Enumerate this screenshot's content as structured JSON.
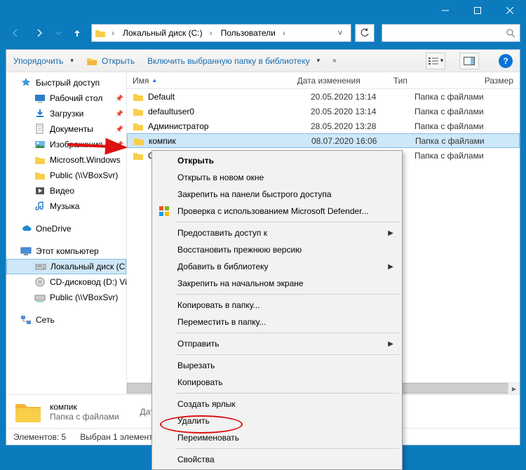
{
  "window": {
    "minimize": "—",
    "maximize": "□",
    "close": "✕"
  },
  "breadcrumbs": [
    {
      "label": "Локальный диск (C:)"
    },
    {
      "label": "Пользователи"
    }
  ],
  "toolbar": {
    "organize": "Упорядочить",
    "open": "Открыть",
    "include": "Включить выбранную папку в библиотеку",
    "help": "?"
  },
  "columns": {
    "name": "Имя",
    "date": "Дата изменения",
    "type": "Тип",
    "size": "Размер"
  },
  "sidebar": {
    "quick": "Быстрый доступ",
    "desktop": "Рабочий стол",
    "downloads": "Загрузки",
    "documents": "Документы",
    "pictures": "Изображения",
    "mswin": "Microsoft.Windows",
    "public": "Public (\\\\VBoxSvr)",
    "videos": "Видео",
    "music": "Музыка",
    "onedrive": "OneDrive",
    "thispc": "Этот компьютер",
    "localdisk": "Локальный диск (C:)",
    "cddrive": "CD-дисковод (D:) Vi",
    "publicnet": "Public (\\\\VBoxSvr)",
    "network": "Сеть"
  },
  "files": [
    {
      "name": "Default",
      "date": "20.05.2020 13:14",
      "type": "Папка с файлами"
    },
    {
      "name": "defaultuser0",
      "date": "20.05.2020 13:14",
      "type": "Папка с файлами"
    },
    {
      "name": "Администратор",
      "date": "28.05.2020 13:28",
      "type": "Папка с файлами"
    },
    {
      "name": "компик",
      "date": "08.07.2020 16:06",
      "type": "Папка с файлами",
      "selected": true
    },
    {
      "name": "Общие",
      "date": "",
      "type": "Папка с файлами",
      "truncated": "О"
    }
  ],
  "details": {
    "title": "компик",
    "sub": "Папка с файлами",
    "meta_label": "Дата"
  },
  "status": {
    "count": "Элементов: 5",
    "selected": "Выбран 1 элемент"
  },
  "context_menu": {
    "open": "Открыть",
    "open_new": "Открыть в новом окне",
    "pin_quick": "Закрепить на панели быстрого доступа",
    "defender": "Проверка с использованием Microsoft Defender...",
    "give_access": "Предоставить доступ к",
    "restore": "Восстановить прежнюю версию",
    "add_library": "Добавить в библиотеку",
    "pin_start": "Закрепить на начальном экране",
    "copy_to": "Копировать в папку...",
    "move_to": "Переместить в папку...",
    "send_to": "Отправить",
    "cut": "Вырезать",
    "copy": "Копировать",
    "shortcut": "Создать ярлык",
    "delete": "Удалить",
    "rename": "Переименовать",
    "properties": "Свойства"
  }
}
